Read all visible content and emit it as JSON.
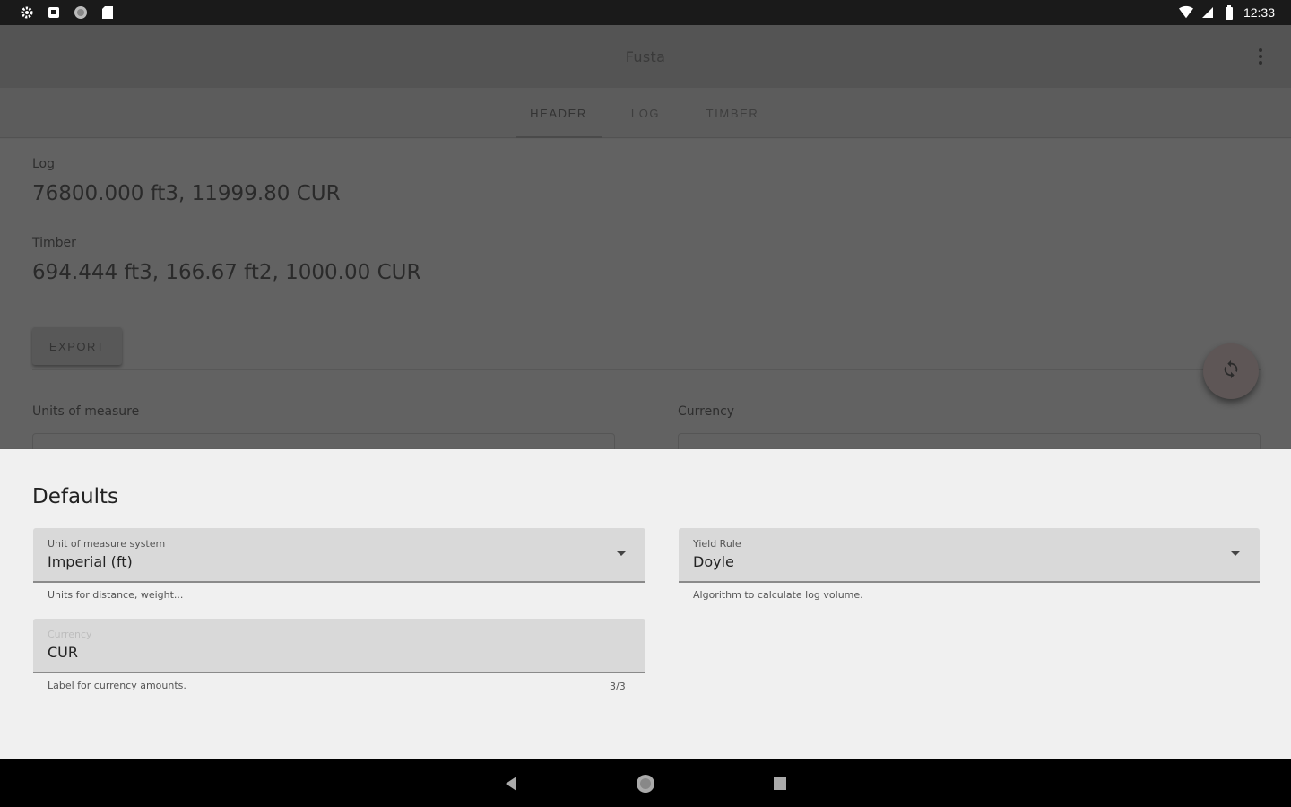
{
  "status_bar": {
    "time": "12:33"
  },
  "app_bar": {
    "title": "Fusta"
  },
  "tabs": [
    {
      "label": "HEADER",
      "active": true
    },
    {
      "label": "LOG",
      "active": false
    },
    {
      "label": "TIMBER",
      "active": false
    }
  ],
  "summary": {
    "log_label": "Log",
    "log_value": "76800.000 ft3, 11999.80 CUR",
    "timber_label": "Timber",
    "timber_value": "694.444 ft3, 166.67 ft2, 1000.00 CUR",
    "export_label": "EXPORT"
  },
  "settings_background": {
    "units_label": "Units of measure",
    "currency_label": "Currency"
  },
  "defaults_sheet": {
    "title": "Defaults",
    "unit_system": {
      "label": "Unit of measure system",
      "value": "Imperial (ft)",
      "helper": "Units for distance, weight..."
    },
    "yield_rule": {
      "label": "Yield Rule",
      "value": "Doyle",
      "helper": "Algorithm to calculate log volume."
    },
    "currency": {
      "label": "Currency",
      "value": "CUR",
      "helper": "Label for currency amounts.",
      "counter": "3/3"
    }
  },
  "colors": {
    "scrim": "#5f5f5f",
    "sheet_background": "#f0f0f0",
    "field_fill": "#d9d9d9"
  },
  "icons": {
    "status_left": [
      "settings-icon",
      "notification-square-icon",
      "circle-icon",
      "sd-card-icon"
    ],
    "status_right": [
      "wifi-icon",
      "signal-icon",
      "battery-icon"
    ],
    "fab": "sync-icon",
    "nav": [
      "back-icon",
      "home-icon",
      "recents-icon"
    ]
  }
}
